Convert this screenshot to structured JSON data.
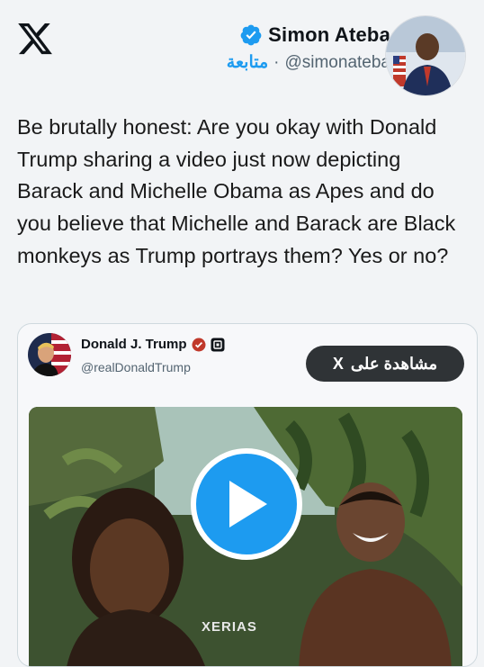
{
  "header": {
    "logo_icon": "x-logo-icon",
    "author_name": "Simon Ateba",
    "verified_icon": "verified-badge-icon",
    "handle": "@simonateba",
    "separator": "·",
    "follow_label": "متابعة"
  },
  "tweet": {
    "text": "Be brutally honest: Are you okay with Donald Trump sharing a video just now depicting Barack and Michelle Obama as Apes and do you believe that Michelle and Barack are Black monkeys as Trump portrays them? Yes or no?"
  },
  "quote": {
    "name": "Donald J. Trump",
    "handle": "@realDonaldTrump",
    "view_button_label": "مشاهدة على",
    "view_button_logo": "X",
    "watermark": "XERIAS"
  },
  "colors": {
    "accent": "#1d9bf0",
    "text": "#0f1419",
    "muted": "#536471",
    "background": "#f2f4f6"
  }
}
